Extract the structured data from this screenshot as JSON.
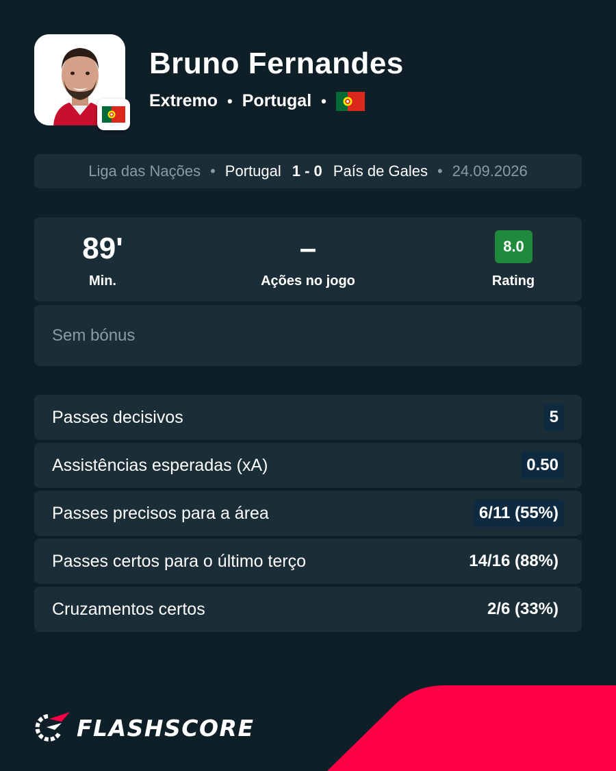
{
  "player": {
    "name": "Bruno Fernandes",
    "position": "Extremo",
    "country": "Portugal",
    "flag_icon": "portugal-flag-icon"
  },
  "match": {
    "competition": "Liga das Nações",
    "home_team": "Portugal",
    "score": "1 - 0",
    "away_team": "País de Gales",
    "date": "24.09.2026"
  },
  "summary": {
    "minutes_value": "89'",
    "minutes_label": "Min.",
    "actions_value": "–",
    "actions_label": "Ações no jogo",
    "rating_value": "8.0",
    "rating_label": "Rating",
    "rating_color": "#1f8a3c"
  },
  "bonus_text": "Sem bónus",
  "stats": [
    {
      "label": "Passes decisivos",
      "value": "5"
    },
    {
      "label": "Assistências esperadas (xA)",
      "value": "0.50"
    },
    {
      "label": "Passes precisos para a área",
      "value": "6/11 (55%)"
    },
    {
      "label": "Passes certos para o último terço",
      "value": "14/16 (88%)"
    },
    {
      "label": "Cruzamentos certos",
      "value": "2/6 (33%)"
    }
  ],
  "brand": {
    "name": "FLASHSCORE",
    "accent": "#ff0046",
    "background": "#0f1f28"
  }
}
